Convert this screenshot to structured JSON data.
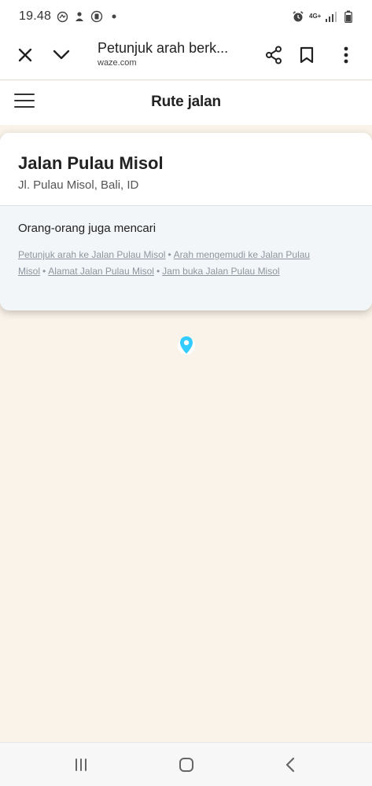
{
  "status_bar": {
    "time": "19.48",
    "network": "4G+"
  },
  "browser": {
    "tab_title": "Petunjuk arah berk...",
    "url": "waze.com",
    "icons": [
      "close-icon",
      "chevron-down-icon",
      "share-icon",
      "bookmark-icon",
      "more-vert-icon"
    ]
  },
  "site": {
    "title": "Rute jalan",
    "menu_icon": "hamburger-icon"
  },
  "place": {
    "name": "Jalan Pulau Misol",
    "address": "Jl. Pulau Misol, Bali, ID"
  },
  "also_searched": {
    "title": "Orang-orang juga mencari",
    "links": [
      "Petunjuk arah ke Jalan Pulau Misol",
      "Arah mengemudi ke Jalan Pulau Misol",
      "Alamat Jalan Pulau Misol",
      "Jam buka Jalan Pulau Misol"
    ],
    "separator": "•"
  },
  "map": {
    "background_color": "#faf3e9",
    "pin_color": "#33ccff",
    "pin_icon": "map-pin-icon"
  },
  "nav_bar": {
    "icons": [
      "recents-icon",
      "home-icon",
      "back-icon"
    ]
  }
}
